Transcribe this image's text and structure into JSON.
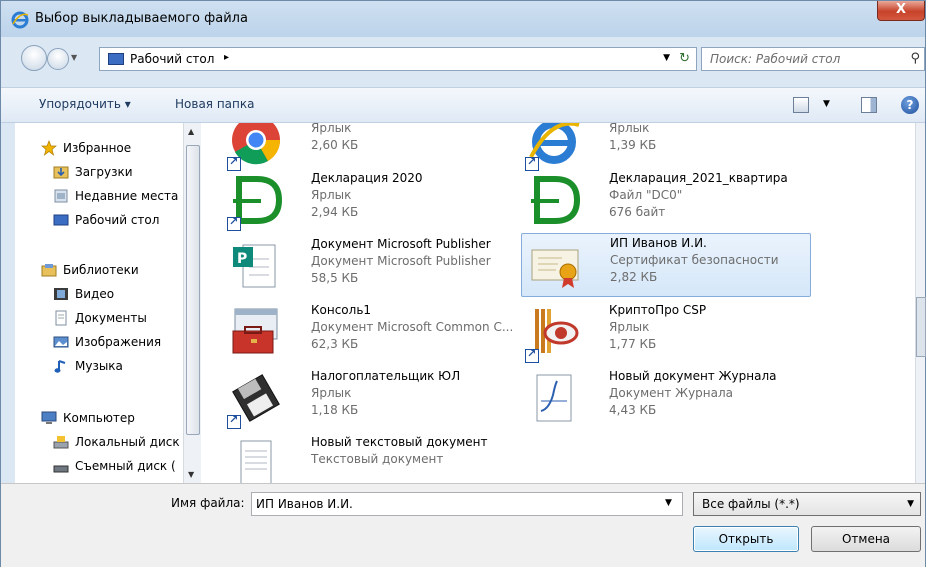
{
  "window": {
    "title": "Выбор выкладываемого файла",
    "close_label": "X"
  },
  "address": {
    "location": "Рабочий стол",
    "chevron": "▸",
    "search_placeholder": "Поиск: Рабочий стол"
  },
  "toolbar": {
    "organize_label": "Упорядочить ▾",
    "new_folder_label": "Новая папка",
    "help_label": "?"
  },
  "navigation": {
    "items": [
      {
        "label": "Избранное",
        "icon": "star-icon"
      },
      {
        "label": "Загрузки",
        "icon": "downloads-folder-icon"
      },
      {
        "label": "Недавние места",
        "icon": "recent-places-icon"
      },
      {
        "label": "Рабочий стол",
        "icon": "desktop-icon"
      },
      {
        "label": "Библиотеки",
        "icon": "libraries-icon"
      },
      {
        "label": "Видео",
        "icon": "video-icon"
      },
      {
        "label": "Документы",
        "icon": "documents-icon"
      },
      {
        "label": "Изображения",
        "icon": "pictures-icon"
      },
      {
        "label": "Музыка",
        "icon": "music-icon"
      },
      {
        "label": "Компьютер",
        "icon": "computer-icon"
      },
      {
        "label": "Локальный диск",
        "icon": "local-disk-icon"
      },
      {
        "label": "Съемный диск (",
        "icon": "removable-disk-icon"
      }
    ]
  },
  "files": [
    {
      "name": "",
      "type": "Ярлык",
      "size": "2,60 КБ",
      "icon": "chrome-icon",
      "shortcut": true,
      "selected": false
    },
    {
      "name": "",
      "type": "Ярлык",
      "size": "1,39 КБ",
      "icon": "internet-explorer-icon",
      "shortcut": true,
      "selected": false
    },
    {
      "name": "Декларация 2020",
      "type": "Ярлык",
      "size": "2,94 КБ",
      "icon": "declaration-icon",
      "shortcut": true,
      "selected": false
    },
    {
      "name": "Декларация_2021_квартира",
      "type": "Файл \"DC0\"",
      "size": "676 байт",
      "icon": "declaration-icon",
      "shortcut": false,
      "selected": false
    },
    {
      "name": "Документ Microsoft Publisher",
      "type": "Документ Microsoft Publisher",
      "size": "58,5 КБ",
      "icon": "publisher-document-icon",
      "shortcut": false,
      "selected": false
    },
    {
      "name": "ИП Иванов И.И.",
      "type": "Сертификат безопасности",
      "size": "2,82 КБ",
      "icon": "certificate-icon",
      "shortcut": false,
      "selected": true
    },
    {
      "name": "Консоль1",
      "type": "Документ Microsoft Common C...",
      "size": "62,3 КБ",
      "icon": "console-toolbox-icon",
      "shortcut": false,
      "selected": false
    },
    {
      "name": "КриптоПро CSP",
      "type": "Ярлык",
      "size": "1,77 КБ",
      "icon": "cryptopro-icon",
      "shortcut": true,
      "selected": false
    },
    {
      "name": "Налогоплательщик ЮЛ",
      "type": "Ярлык",
      "size": "1,18 КБ",
      "icon": "floppy-disk-icon",
      "shortcut": true,
      "selected": false
    },
    {
      "name": "Новый документ Журнала",
      "type": "Документ Журнала",
      "size": "4,43 КБ",
      "icon": "journal-document-icon",
      "shortcut": false,
      "selected": false
    },
    {
      "name": "Новый текстовый документ",
      "type": "Текстовый документ",
      "size": "",
      "icon": "text-document-icon",
      "shortcut": false,
      "selected": false
    }
  ],
  "bottom": {
    "filename_label": "Имя файла:",
    "filename_value": "ИП Иванов И.И.",
    "filter_value": "Все файлы (*.*)",
    "open_label": "Открыть",
    "cancel_label": "Отмена"
  }
}
